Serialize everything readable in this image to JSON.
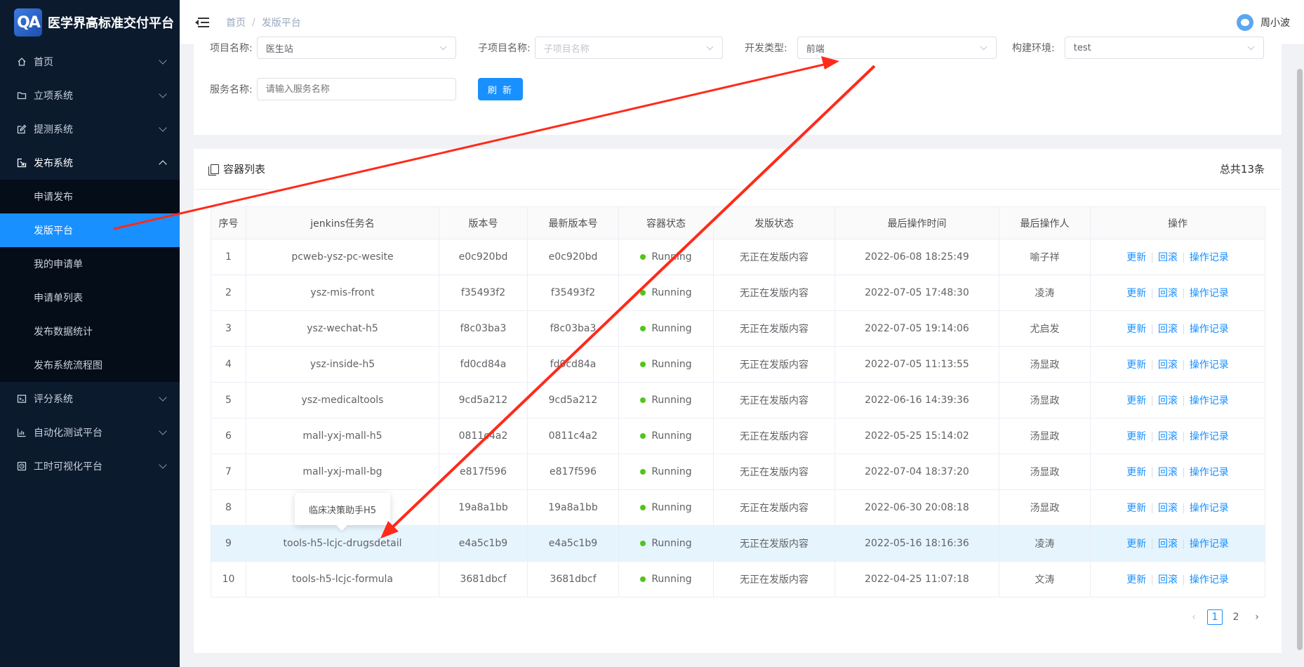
{
  "app": {
    "logo_text": "QA",
    "title": "医学界高标准交付平台"
  },
  "header": {
    "breadcrumb": {
      "home": "首页",
      "sep": "/",
      "current": "发版平台"
    },
    "user": {
      "name": "周小波"
    }
  },
  "sidebar": {
    "items": [
      {
        "label": "首页",
        "icon": "home-icon"
      },
      {
        "label": "立项系统",
        "icon": "folder-icon"
      },
      {
        "label": "提测系统",
        "icon": "edit-icon"
      },
      {
        "label": "发布系统",
        "icon": "release-icon",
        "open": true,
        "children": [
          "申请发布",
          "发版平台",
          "我的申请单",
          "申请单列表",
          "发布数据统计",
          "发布系统流程图"
        ]
      },
      {
        "label": "评分系统",
        "icon": "terminal-icon"
      },
      {
        "label": "自动化测试平台",
        "icon": "chart-icon"
      },
      {
        "label": "工时可视化平台",
        "icon": "clock-icon"
      }
    ],
    "active_child": "发版平台"
  },
  "filters": {
    "project": {
      "label": "项目名称:",
      "value": "医生站"
    },
    "subproject": {
      "label": "子项目名称:",
      "placeholder": "子项目名称"
    },
    "dev_type": {
      "label": "开发类型:",
      "value": "前端"
    },
    "build_env": {
      "label": "构建环境:",
      "value": "test"
    },
    "service": {
      "label": "服务名称:",
      "placeholder": "请输入服务名称"
    },
    "refresh_label": "刷 新"
  },
  "list": {
    "title": "容器列表",
    "total": "总共13条",
    "columns": [
      "序号",
      "jenkins任务名",
      "版本号",
      "最新版本号",
      "容器状态",
      "发版状态",
      "最后操作时间",
      "最后操作人",
      "操作"
    ],
    "rows": [
      {
        "no": "1",
        "job": "pcweb-ysz-pc-wesite",
        "ver": "e0c920bd",
        "latest": "e0c920bd",
        "status": "Running",
        "release": "无正在发版内容",
        "time": "2022-06-08 18:25:49",
        "user": "喻子祥"
      },
      {
        "no": "2",
        "job": "ysz-mis-front",
        "ver": "f35493f2",
        "latest": "f35493f2",
        "status": "Running",
        "release": "无正在发版内容",
        "time": "2022-07-05 17:48:30",
        "user": "凌涛"
      },
      {
        "no": "3",
        "job": "ysz-wechat-h5",
        "ver": "f8c03ba3",
        "latest": "f8c03ba3",
        "status": "Running",
        "release": "无正在发版内容",
        "time": "2022-07-05 19:14:06",
        "user": "尤启发"
      },
      {
        "no": "4",
        "job": "ysz-inside-h5",
        "ver": "fd0cd84a",
        "latest": "fd0cd84a",
        "status": "Running",
        "release": "无正在发版内容",
        "time": "2022-07-05 11:13:55",
        "user": "汤显政"
      },
      {
        "no": "5",
        "job": "ysz-medicaltools",
        "ver": "9cd5a212",
        "latest": "9cd5a212",
        "status": "Running",
        "release": "无正在发版内容",
        "time": "2022-06-16 14:39:36",
        "user": "汤显政"
      },
      {
        "no": "6",
        "job": "mall-yxj-mall-h5",
        "ver": "0811c4a2",
        "latest": "0811c4a2",
        "status": "Running",
        "release": "无正在发版内容",
        "time": "2022-05-25 15:14:02",
        "user": "汤显政"
      },
      {
        "no": "7",
        "job": "mall-yxj-mall-bg",
        "ver": "e817f596",
        "latest": "e817f596",
        "status": "Running",
        "release": "无正在发版内容",
        "time": "2022-07-04 18:37:20",
        "user": "汤显政"
      },
      {
        "no": "8",
        "job": "",
        "ver": "19a8a1bb",
        "latest": "19a8a1bb",
        "status": "Running",
        "release": "无正在发版内容",
        "time": "2022-06-30 20:08:18",
        "user": "汤显政"
      },
      {
        "no": "9",
        "job": "tools-h5-lcjc-drugsdetail",
        "ver": "e4a5c1b9",
        "latest": "e4a5c1b9",
        "status": "Running",
        "release": "无正在发版内容",
        "time": "2022-05-16 18:16:36",
        "user": "凌涛",
        "highlight": true
      },
      {
        "no": "10",
        "job": "tools-h5-lcjc-formula",
        "ver": "3681dbcf",
        "latest": "3681dbcf",
        "status": "Running",
        "release": "无正在发版内容",
        "time": "2022-04-25 11:07:18",
        "user": "文涛"
      }
    ],
    "actions": [
      "更新",
      "回滚",
      "操作记录"
    ],
    "tooltip": "临床决策助手H5"
  },
  "pagination": {
    "prev": "‹",
    "pages": [
      "1",
      "2"
    ],
    "current": "1",
    "next": "›"
  },
  "colors": {
    "sidebar_bg": "#0c1a2e",
    "accent": "#1890ff",
    "version_green": "#3fb618",
    "running_dot": "#52c41a",
    "annotation_arrow": "#ff2a1a"
  }
}
